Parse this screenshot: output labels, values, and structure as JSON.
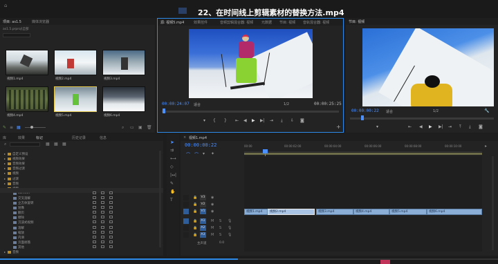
{
  "title": "22、在时间线上剪辑素材的替换方法.mp4",
  "colors": {
    "accent_blue": "#2d8ceb",
    "timecode": "#4c8fff",
    "clip_blue": "#8aaed6",
    "bin_orange": "#b78a2a"
  },
  "project_panel": {
    "tabs": [
      "项目: as1.5",
      "媒体浏览器"
    ],
    "path": "as1.5.prproj\\全部",
    "thumbs": [
      {
        "label": "视频1.mp4",
        "duration": ""
      },
      {
        "label": "视频2.mp4",
        "duration": ""
      },
      {
        "label": "视频3.mp4",
        "duration": ""
      },
      {
        "label": "视频4.mp4",
        "duration": ""
      },
      {
        "label": "视频5.mp4",
        "duration": ""
      },
      {
        "label": "视频6.mp4",
        "duration": ""
      }
    ]
  },
  "source_monitor": {
    "tabs": [
      "源: 视频5.mp4",
      "效果控件",
      "音频剪辑混合器: 视频",
      "元数据",
      "节目: 视频",
      "音轨混合器: 视频"
    ],
    "timecode_left": "00:00:24:07",
    "fit": "适合",
    "fraction": "1/2",
    "timecode_right": "00:00:25:25"
  },
  "program_monitor": {
    "tabs": [
      "节目: 视频"
    ],
    "timecode_left": "00:00:00:22",
    "fit": "适合",
    "fraction": "1/2"
  },
  "bins_panel": {
    "tabs": [
      "库",
      "效果",
      "标记",
      "历史记录",
      "信息"
    ],
    "rows": [
      {
        "label": "自定义预设",
        "open": false
      },
      {
        "label": "视频效果",
        "open": false
      },
      {
        "label": "音频效果",
        "open": false
      },
      {
        "label": "音频过渡",
        "open": false
      },
      {
        "label": "视频",
        "open": false
      },
      {
        "label": "过渡",
        "open": false
      },
      {
        "label": "音频",
        "open": false
      },
      {
        "label": "视频",
        "open": true
      },
      {
        "label": "Lumetri",
        "open": false
      },
      {
        "label": "交叉溶解",
        "open": false
      },
      {
        "label": "立方体旋转",
        "open": false
      },
      {
        "label": "划像",
        "open": false
      },
      {
        "label": "翻页",
        "open": false
      },
      {
        "label": "擦除",
        "open": false
      },
      {
        "label": "沉浸式视频",
        "open": false
      },
      {
        "label": "溶解",
        "open": false
      },
      {
        "label": "缩放",
        "open": false
      },
      {
        "label": "内滑",
        "open": false
      },
      {
        "label": "页面剥落",
        "open": false
      },
      {
        "label": "其他",
        "open": false
      },
      {
        "label": "音频",
        "open": false
      }
    ]
  },
  "timeline": {
    "timecode": "00:00:00:22",
    "ruler": [
      "00:00",
      "00:00:02:00",
      "00:00:04:00",
      "00:00:06:00",
      "00:00:08:00",
      "00:00:10:00"
    ],
    "tracks": [
      "V3",
      "V2",
      "V1",
      "A1",
      "A2",
      "A3"
    ],
    "track_labels": [
      "V1",
      "A1",
      "A2",
      "A3"
    ],
    "master": "主声道",
    "clips": [
      {
        "label": "视频1.mp4"
      },
      {
        "label": "视频2.mp4"
      },
      {
        "label": "视频3.mp4"
      },
      {
        "label": "视频4.mp4"
      },
      {
        "label": "视频5.mp4"
      },
      {
        "label": "视频6.mp4"
      }
    ]
  }
}
